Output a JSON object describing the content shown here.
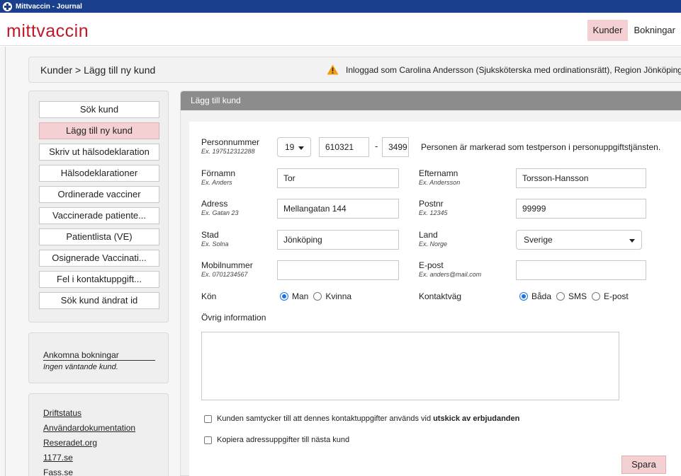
{
  "window": {
    "title": "Mittvaccin - Journal"
  },
  "header": {
    "logo": "mittvaccin",
    "nav": [
      {
        "label": "Kunder"
      },
      {
        "label": "Bokningar"
      }
    ]
  },
  "breadcrumb": {
    "path": "Kunder > Lägg till ny kund",
    "login_text": "Inloggad som Carolina Andersson (Sjuksköterska med ordinationsrätt), Region Jönköpings län"
  },
  "sidebar": {
    "menu": [
      {
        "label": "Sök kund"
      },
      {
        "label": "Lägg till ny kund"
      },
      {
        "label": "Skriv ut hälsodeklaration"
      },
      {
        "label": "Hälsodeklarationer"
      },
      {
        "label": "Ordinerade vacciner"
      },
      {
        "label": "Vaccinerade patiente..."
      },
      {
        "label": "Patientlista (VE)"
      },
      {
        "label": "Osignerade Vaccinati..."
      },
      {
        "label": "Fel i kontaktuppgift..."
      },
      {
        "label": "Sök kund ändrat id"
      }
    ],
    "active_index": 1,
    "bookings": {
      "title": "Ankomna bokningar",
      "empty_text": "Ingen väntande kund."
    },
    "links": [
      {
        "label": "Driftstatus"
      },
      {
        "label": "Användardokumentation"
      },
      {
        "label": "Reseradet.org"
      },
      {
        "label": "1177.se"
      },
      {
        "label": "Fass.se"
      }
    ]
  },
  "form": {
    "title": "Lägg till kund",
    "personnummer": {
      "label": "Personnummer",
      "example": "Ex. 197512312288",
      "century": "19",
      "date": "610321",
      "separator": "-",
      "suffix": "3499",
      "note": "Personen är markerad som testperson i personuppgiftstjänsten."
    },
    "fornamn": {
      "label": "Förnamn",
      "example": "Ex. Anders",
      "value": "Tor"
    },
    "efternamn": {
      "label": "Efternamn",
      "example": "Ex. Andersson",
      "value": "Torsson-Hansson"
    },
    "adress": {
      "label": "Adress",
      "example": "Ex. Gatan 23",
      "value": "Mellangatan 144"
    },
    "postnr": {
      "label": "Postnr",
      "example": "Ex. 12345",
      "value": "99999"
    },
    "stad": {
      "label": "Stad",
      "example": "Ex. Solna",
      "value": "Jönköping"
    },
    "land": {
      "label": "Land",
      "example": "Ex. Norge",
      "value": "Sverige"
    },
    "mobil": {
      "label": "Mobilnummer",
      "example": "Ex. 0701234567",
      "value": ""
    },
    "epost": {
      "label": "E-post",
      "example": "Ex. anders@mail.com",
      "value": ""
    },
    "kon": {
      "label": "Kön",
      "options": [
        "Man",
        "Kvinna"
      ],
      "selected": "Man"
    },
    "kontaktvag": {
      "label": "Kontaktväg",
      "options": [
        "Båda",
        "SMS",
        "E-post"
      ],
      "selected": "Båda"
    },
    "ovrig": {
      "label": "Övrig information",
      "value": ""
    },
    "consent": {
      "text": "Kunden samtycker till att dennes kontaktuppgifter används vid",
      "bold": "utskick av erbjudanden",
      "checked": false
    },
    "copy_address": {
      "text": "Kopiera adressuppgifter till nästa kund",
      "checked": false
    },
    "save_label": "Spara"
  }
}
